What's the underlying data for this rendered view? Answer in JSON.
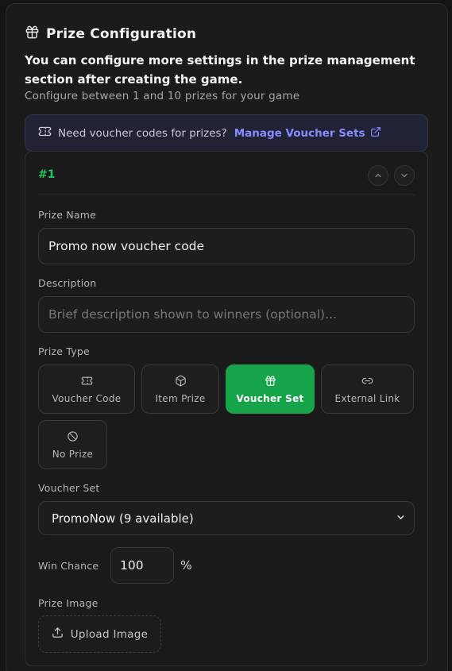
{
  "header": {
    "icon": "gift-icon",
    "title": "Prize Configuration",
    "lead": "You can configure more settings in the prize management section after creating the game.",
    "sub": "Configure between 1 and 10 prizes for your game"
  },
  "banner": {
    "icon": "ticket-icon",
    "text": "Need voucher codes for prizes?",
    "link": "Manage Voucher Sets",
    "link_icon": "external-link-icon"
  },
  "prize": {
    "number": "#1",
    "name_label": "Prize Name",
    "name_value": "Promo now voucher code",
    "description_label": "Description",
    "description_placeholder": "Brief description shown to winners (optional)...",
    "type_label": "Prize Type",
    "types": [
      {
        "label": "Voucher Code",
        "icon": "ticket-icon",
        "active": false
      },
      {
        "label": "Item Prize",
        "icon": "box-icon",
        "active": false
      },
      {
        "label": "Voucher Set",
        "icon": "gift-icon",
        "active": true
      },
      {
        "label": "External Link",
        "icon": "link-icon",
        "active": false
      },
      {
        "label": "No Prize",
        "icon": "ban-icon",
        "active": false
      }
    ],
    "voucher_set_label": "Voucher Set",
    "voucher_set_value": "PromoNow (9 available)",
    "win_chance_label": "Win Chance",
    "win_chance_value": "100",
    "win_chance_unit": "%",
    "image_label": "Prize Image",
    "upload_label": "Upload Image"
  },
  "colors": {
    "accent_green": "#16a34a",
    "prize_number": "#22c55e",
    "link": "#8b8bff"
  }
}
